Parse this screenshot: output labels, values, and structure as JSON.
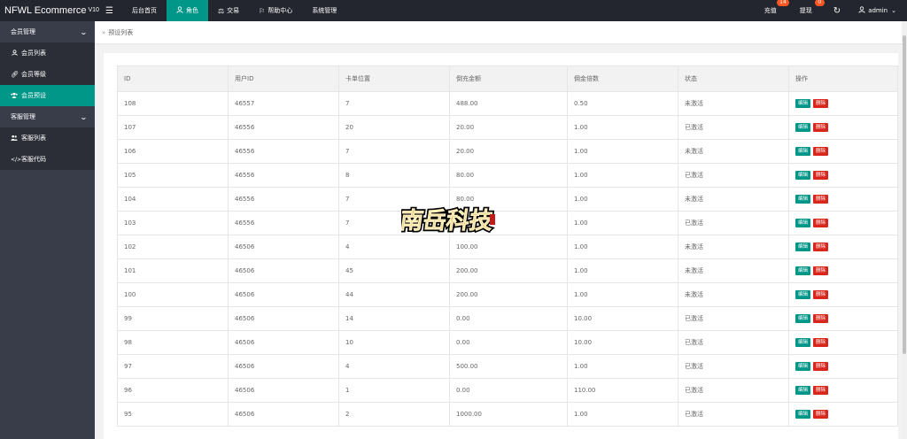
{
  "app": {
    "name": "NFWL Ecommerce",
    "version": "V10"
  },
  "topnav": [
    {
      "label": "后台首页",
      "icon": "home-icon"
    },
    {
      "label": "角色",
      "icon": "user-icon",
      "active": true
    },
    {
      "label": "交易",
      "icon": "scale-icon"
    },
    {
      "label": "帮助中心",
      "icon": "flag-icon"
    },
    {
      "label": "系统管理",
      "icon": ""
    }
  ],
  "topright": {
    "recharge": {
      "label": "充值",
      "badge": "14"
    },
    "withdraw": {
      "label": "提现",
      "badge": "0"
    },
    "user": "admin"
  },
  "sidebar": {
    "groups": [
      {
        "label": "会员管理",
        "items": [
          {
            "label": "会员列表",
            "icon": "user-icon"
          },
          {
            "label": "会员等级",
            "icon": "link-icon"
          },
          {
            "label": "会员预设",
            "icon": "users-icon",
            "active": true
          }
        ]
      },
      {
        "label": "客服管理",
        "items": [
          {
            "label": "客服列表",
            "icon": "group-icon"
          },
          {
            "label": "客服代码",
            "icon": "code-icon"
          }
        ]
      }
    ]
  },
  "breadcrumb": {
    "sep": "»",
    "label": "预设列表"
  },
  "table": {
    "headers": [
      "ID",
      "用户ID",
      "卡单位置",
      "倒充金额",
      "佣金倍数",
      "状态",
      "操作"
    ],
    "edit_label": "编辑",
    "delete_label": "删除",
    "rows": [
      [
        "108",
        "46557",
        "7",
        "488.00",
        "0.50",
        "未激活"
      ],
      [
        "107",
        "46556",
        "20",
        "20.00",
        "1.00",
        "已激活"
      ],
      [
        "106",
        "46556",
        "7",
        "20.00",
        "1.00",
        "未激活"
      ],
      [
        "105",
        "46556",
        "8",
        "80.00",
        "1.00",
        "已激活"
      ],
      [
        "104",
        "46556",
        "7",
        "80.00",
        "1.00",
        "未激活"
      ],
      [
        "103",
        "46556",
        "7",
        "",
        "1.00",
        "已激活"
      ],
      [
        "102",
        "46506",
        "4",
        "100.00",
        "1.00",
        "未激活"
      ],
      [
        "101",
        "46506",
        "45",
        "200.00",
        "1.00",
        "未激活"
      ],
      [
        "100",
        "46506",
        "44",
        "200.00",
        "1.00",
        "未激活"
      ],
      [
        "99",
        "46506",
        "14",
        "0.00",
        "10.00",
        "已激活"
      ],
      [
        "98",
        "46506",
        "10",
        "0.00",
        "10.00",
        "已激活"
      ],
      [
        "97",
        "46506",
        "4",
        "500.00",
        "1.00",
        "已激活"
      ],
      [
        "96",
        "46506",
        "1",
        "0.00",
        "110.00",
        "已激活"
      ],
      [
        "95",
        "46506",
        "2",
        "1000.00",
        "1.00",
        "已激活"
      ]
    ]
  },
  "watermark": {
    "text": "南岳科技"
  },
  "colors": {
    "accent": "#009688",
    "danger": "#d9261c",
    "topbar": "#23262e",
    "sidebar": "#393d49",
    "badge": "#ff5722"
  }
}
